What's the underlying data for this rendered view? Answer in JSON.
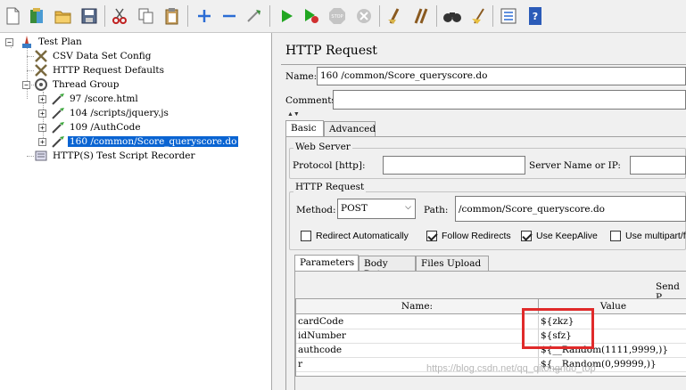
{
  "toolbar": {
    "buttons": [
      "new-icon",
      "templates-icon",
      "open-icon",
      "save-icon",
      "cut-icon",
      "copy-icon",
      "paste-icon",
      "expand-icon",
      "collapse-icon",
      "toggle-icon",
      "start-icon",
      "start-no-pause-icon",
      "stop-icon",
      "shutdown-icon",
      "clear-icon",
      "clear-all-icon",
      "search-icon",
      "reset-search-icon",
      "function-helper-icon",
      "help-icon"
    ]
  },
  "tree": {
    "nodes": [
      {
        "label": "Test Plan"
      },
      {
        "label": "CSV Data Set Config"
      },
      {
        "label": "HTTP Request Defaults"
      },
      {
        "label": "Thread Group"
      },
      {
        "label": "97 /score.html"
      },
      {
        "label": "104 /scripts/jquery.js"
      },
      {
        "label": "109 /AuthCode"
      },
      {
        "label": "160 /common/Score_queryscore.do"
      },
      {
        "label": "HTTP(S) Test Script Recorder"
      }
    ]
  },
  "panel": {
    "title": "HTTP Request",
    "name_label": "Name:",
    "name_value": "160 /common/Score_queryscore.do",
    "comments_label": "Comments:",
    "tabs": [
      "Basic",
      "Advanced"
    ],
    "web_server": {
      "title": "Web Server",
      "protocol_label": "Protocol [http]:",
      "protocol_value": "",
      "server_label": "Server Name or IP:",
      "server_value": ""
    },
    "http_request": {
      "title": "HTTP Request",
      "method_label": "Method:",
      "method_value": "POST",
      "path_label": "Path:",
      "path_value": "/common/Score_queryscore.do"
    },
    "checkboxes": [
      {
        "label": "Redirect Automatically",
        "checked": false
      },
      {
        "label": "Follow Redirects",
        "checked": true
      },
      {
        "label": "Use KeepAlive",
        "checked": true
      },
      {
        "label": "Use multipart/fo",
        "checked": false
      }
    ],
    "sub_tabs": [
      "Parameters",
      "Body Data",
      "Files Upload"
    ],
    "send_label": "Send P",
    "table": {
      "headers": [
        "Name:",
        "Value"
      ],
      "rows": [
        {
          "name": "cardCode",
          "value": "${zkz}"
        },
        {
          "name": "idNumber",
          "value": "${sfz}"
        },
        {
          "name": "authcode",
          "value": "${__Random(1111,9999,)}"
        },
        {
          "name": "r",
          "value": "${__Random(0,99999,)}"
        }
      ]
    }
  },
  "watermark": "https://blog.csdn.net/qq_qitongnuo_top",
  "colors": {
    "selection": "#0a64d2",
    "highlight": "#e02a2a",
    "run": "#21a621"
  }
}
